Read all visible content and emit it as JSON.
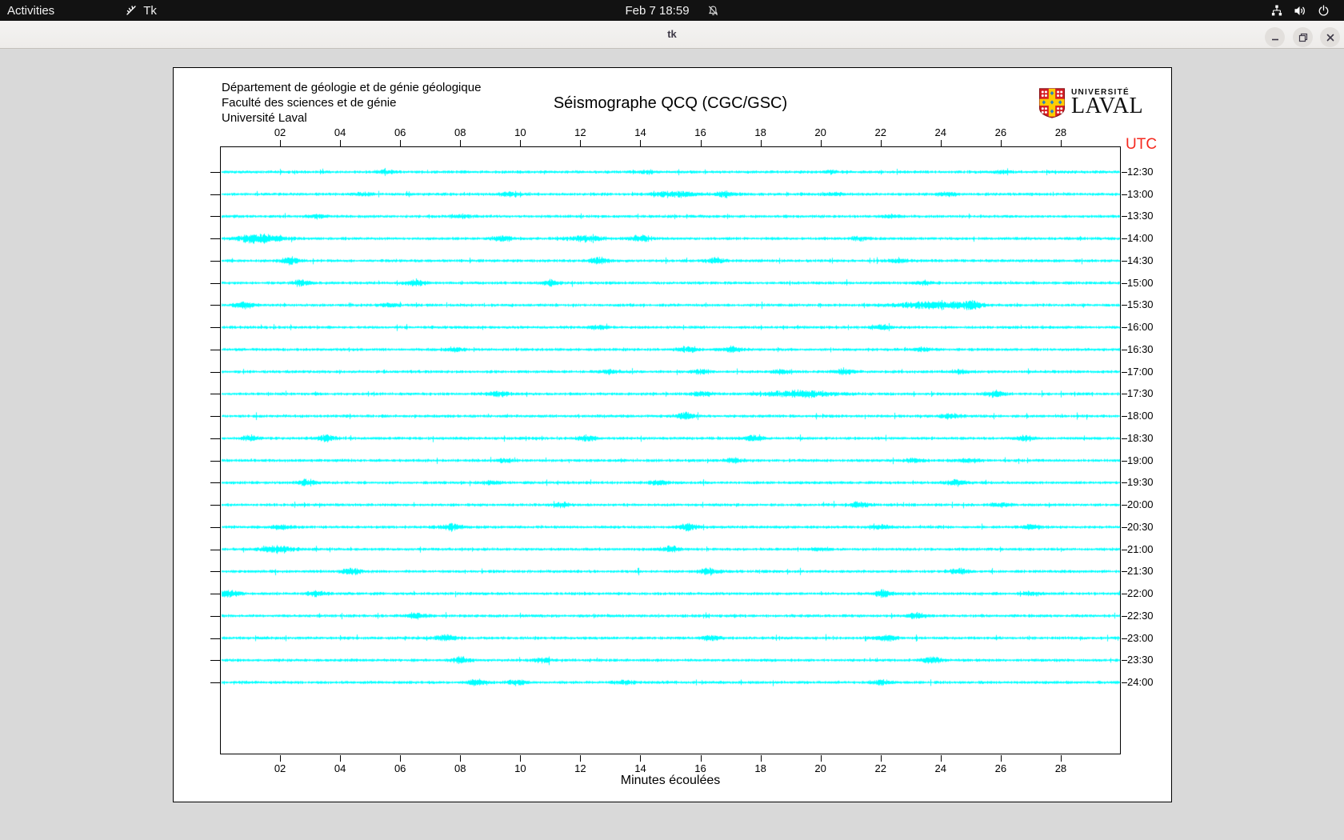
{
  "desktop": {
    "top_bar": {
      "activities_label": "Activities",
      "app_icon": "tk-feather-icon",
      "app_name": "Tk",
      "clock": "Feb 7 18:59",
      "notifications_icon": "bell-slash-icon",
      "tray_icons": [
        "network-icon",
        "volume-icon",
        "power-icon"
      ]
    },
    "window": {
      "title": "tk",
      "controls": [
        "minimize",
        "maximize",
        "close"
      ]
    }
  },
  "seismograph": {
    "org_lines": [
      "Département de géologie et de génie géologique",
      "Faculté des sciences et de génie",
      "Université Laval"
    ],
    "title": "Séismographe QCQ (CGC/GSC)",
    "logo": {
      "top": "UNIVERSITÉ",
      "bottom": "LAVAL"
    },
    "utc_label": "UTC",
    "xlabel": "Minutes écoulées",
    "colors": {
      "trace": "#00ffff",
      "utc_label": "#f5291f",
      "axis": "#000000"
    },
    "x_axis": {
      "range_minutes": [
        0,
        30
      ],
      "ticks": [
        "02",
        "04",
        "06",
        "08",
        "10",
        "12",
        "14",
        "16",
        "18",
        "20",
        "22",
        "24",
        "26",
        "28"
      ]
    },
    "rows": [
      {
        "label": "12:30",
        "bursts": [
          {
            "m": 5.5,
            "a": 1.5
          },
          {
            "m": 14.2,
            "a": 1.5
          },
          {
            "m": 20.3,
            "a": 1.2
          },
          {
            "m": 26,
            "a": 1.2
          }
        ]
      },
      {
        "label": "13:00",
        "bursts": [
          {
            "m": 4.8,
            "a": 2
          },
          {
            "m": 9.6,
            "a": 2.5
          },
          {
            "m": 15.2,
            "a": 3,
            "w": 0.5
          },
          {
            "m": 16.8,
            "a": 2.5
          },
          {
            "m": 20.5,
            "a": 1.5
          },
          {
            "m": 24.2,
            "a": 2
          }
        ]
      },
      {
        "label": "13:30",
        "bursts": [
          {
            "m": 3.2,
            "a": 1.5
          },
          {
            "m": 8,
            "a": 1.8
          },
          {
            "m": 22.3,
            "a": 1.5
          }
        ]
      },
      {
        "label": "14:00",
        "bursts": [
          {
            "m": 1.3,
            "a": 5,
            "w": 0.5
          },
          {
            "m": 9.4,
            "a": 3
          },
          {
            "m": 12.2,
            "a": 3,
            "w": 0.4
          },
          {
            "m": 14,
            "a": 3.5
          },
          {
            "m": 21.3,
            "a": 2
          }
        ]
      },
      {
        "label": "14:30",
        "bursts": [
          {
            "m": 2.3,
            "a": 3.5
          },
          {
            "m": 12.6,
            "a": 3
          },
          {
            "m": 16.5,
            "a": 3
          },
          {
            "m": 22.6,
            "a": 2
          }
        ]
      },
      {
        "label": "15:00",
        "bursts": [
          {
            "m": 2.7,
            "a": 3
          },
          {
            "m": 6.5,
            "a": 3.5
          },
          {
            "m": 11,
            "a": 2.5
          },
          {
            "m": 23.4,
            "a": 2
          }
        ]
      },
      {
        "label": "15:30",
        "bursts": [
          {
            "m": 0.8,
            "a": 3.5
          },
          {
            "m": 5.6,
            "a": 2
          },
          {
            "m": 23.8,
            "a": 3.5,
            "w": 0.9
          },
          {
            "m": 25,
            "a": 4
          }
        ]
      },
      {
        "label": "16:00",
        "bursts": [
          {
            "m": 12.6,
            "a": 1.8
          },
          {
            "m": 22,
            "a": 2.2
          }
        ]
      },
      {
        "label": "16:30",
        "bursts": [
          {
            "m": 7.8,
            "a": 2
          },
          {
            "m": 15.6,
            "a": 3
          },
          {
            "m": 17,
            "a": 3
          },
          {
            "m": 23.4,
            "a": 1.6
          }
        ]
      },
      {
        "label": "17:00",
        "bursts": [
          {
            "m": 13,
            "a": 2.5
          },
          {
            "m": 16,
            "a": 2
          },
          {
            "m": 18.7,
            "a": 2.5
          },
          {
            "m": 20.8,
            "a": 3
          },
          {
            "m": 24.6,
            "a": 2
          }
        ]
      },
      {
        "label": "17:30",
        "bursts": [
          {
            "m": 9.3,
            "a": 2.5
          },
          {
            "m": 16,
            "a": 2.5
          },
          {
            "m": 19.3,
            "a": 3.5,
            "w": 0.8
          },
          {
            "m": 25.8,
            "a": 3.5
          }
        ]
      },
      {
        "label": "18:00",
        "bursts": [
          {
            "m": 15.5,
            "a": 3.5
          },
          {
            "m": 24.3,
            "a": 2.5
          }
        ]
      },
      {
        "label": "18:30",
        "bursts": [
          {
            "m": 1,
            "a": 2.5
          },
          {
            "m": 3.5,
            "a": 3.5
          },
          {
            "m": 12.2,
            "a": 3
          },
          {
            "m": 17.8,
            "a": 3
          },
          {
            "m": 26.8,
            "a": 2.5
          }
        ]
      },
      {
        "label": "19:00",
        "bursts": [
          {
            "m": 9.5,
            "a": 2
          },
          {
            "m": 17.1,
            "a": 2.5
          },
          {
            "m": 23.1,
            "a": 2.5
          },
          {
            "m": 25,
            "a": 2
          }
        ]
      },
      {
        "label": "19:30",
        "bursts": [
          {
            "m": 2.9,
            "a": 3
          },
          {
            "m": 9,
            "a": 2
          },
          {
            "m": 14.6,
            "a": 2.5
          },
          {
            "m": 24.5,
            "a": 3
          }
        ]
      },
      {
        "label": "20:00",
        "bursts": [
          {
            "m": 11.4,
            "a": 2.2
          },
          {
            "m": 21.3,
            "a": 3
          },
          {
            "m": 26,
            "a": 2
          }
        ]
      },
      {
        "label": "20:30",
        "bursts": [
          {
            "m": 2,
            "a": 2.2
          },
          {
            "m": 7.7,
            "a": 3.5
          },
          {
            "m": 15.6,
            "a": 3.5
          },
          {
            "m": 22,
            "a": 2.5
          },
          {
            "m": 27,
            "a": 2.5
          }
        ]
      },
      {
        "label": "21:00",
        "bursts": [
          {
            "m": 1.9,
            "a": 3.5,
            "w": 0.4
          },
          {
            "m": 15,
            "a": 3
          },
          {
            "m": 20,
            "a": 1.8
          }
        ]
      },
      {
        "label": "21:30",
        "bursts": [
          {
            "m": 4.4,
            "a": 3.5
          },
          {
            "m": 16.3,
            "a": 3
          },
          {
            "m": 24.6,
            "a": 3
          }
        ]
      },
      {
        "label": "22:00",
        "bursts": [
          {
            "m": 0.3,
            "a": 3.5
          },
          {
            "m": 3.2,
            "a": 3
          },
          {
            "m": 22.1,
            "a": 3.5
          },
          {
            "m": 27,
            "a": 1.8
          }
        ]
      },
      {
        "label": "22:30",
        "bursts": [
          {
            "m": 6.5,
            "a": 3
          },
          {
            "m": 23.2,
            "a": 2.8
          }
        ]
      },
      {
        "label": "23:00",
        "bursts": [
          {
            "m": 7.5,
            "a": 3.2
          },
          {
            "m": 16.3,
            "a": 2.5
          },
          {
            "m": 22.2,
            "a": 3
          }
        ]
      },
      {
        "label": "23:30",
        "bursts": [
          {
            "m": 8,
            "a": 3.2
          },
          {
            "m": 10.7,
            "a": 2.2
          },
          {
            "m": 23.7,
            "a": 3.5
          }
        ]
      },
      {
        "label": "24:00",
        "bursts": [
          {
            "m": 8.5,
            "a": 3
          },
          {
            "m": 9.9,
            "a": 3
          },
          {
            "m": 13.5,
            "a": 2.5
          },
          {
            "m": 22,
            "a": 2.8
          }
        ]
      }
    ]
  }
}
